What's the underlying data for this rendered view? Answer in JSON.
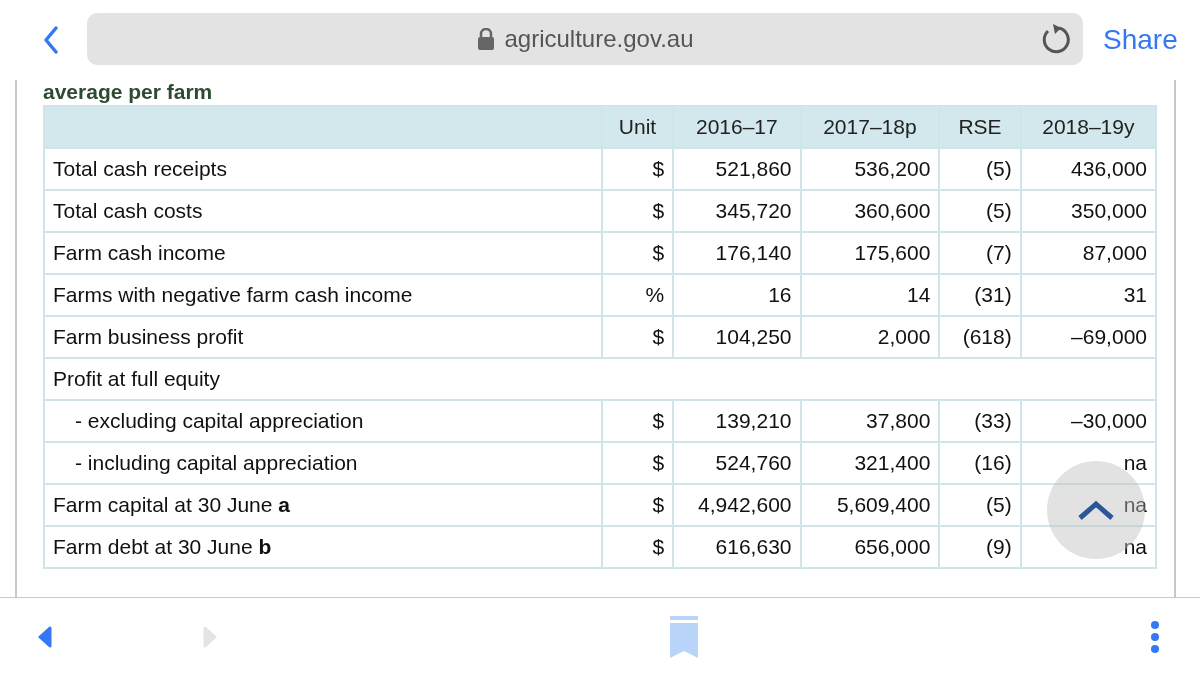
{
  "browser": {
    "url": "agriculture.gov.au",
    "secure": true,
    "share": "Share"
  },
  "heading": "average per farm",
  "table": {
    "columns": [
      "",
      "Unit",
      "2016–17",
      "2017–18p",
      "RSE",
      "2018–19y"
    ],
    "rows": [
      {
        "label": "Total cash receipts",
        "values": [
          "$",
          "521,860",
          "536,200",
          "(5)",
          "436,000"
        ]
      },
      {
        "label": "Total cash costs",
        "values": [
          "$",
          "345,720",
          "360,600",
          "(5)",
          "350,000"
        ]
      },
      {
        "label": "Farm cash income",
        "values": [
          "$",
          "176,140",
          "175,600",
          "(7)",
          "87,000"
        ]
      },
      {
        "label": "Farms with negative farm cash income",
        "values": [
          "%",
          "16",
          "14",
          "(31)",
          "31"
        ]
      },
      {
        "label": "Farm business profit",
        "values": [
          "$",
          "104,250",
          "2,000",
          "(618)",
          "–69,000"
        ]
      },
      {
        "label": "Profit at full equity",
        "values": [],
        "children": [
          {
            "label": "- excluding capital appreciation",
            "values": [
              "$",
              "139,210",
              "37,800",
              "(33)",
              "–30,000"
            ]
          },
          {
            "label": "- including capital appreciation",
            "values": [
              "$",
              "524,760",
              "321,400",
              "(16)",
              "na"
            ]
          }
        ]
      },
      {
        "label": "Farm capital at 30 June **a**",
        "values": [
          "$",
          "4,942,600",
          "5,609,400",
          "(5)",
          "na"
        ]
      },
      {
        "label": "Farm debt at 30 June **b**",
        "values": [
          "$",
          "616,630",
          "656,000",
          "(9)",
          "na"
        ]
      }
    ]
  },
  "toolbar": {
    "back_disabled": false,
    "forward_disabled": true
  }
}
